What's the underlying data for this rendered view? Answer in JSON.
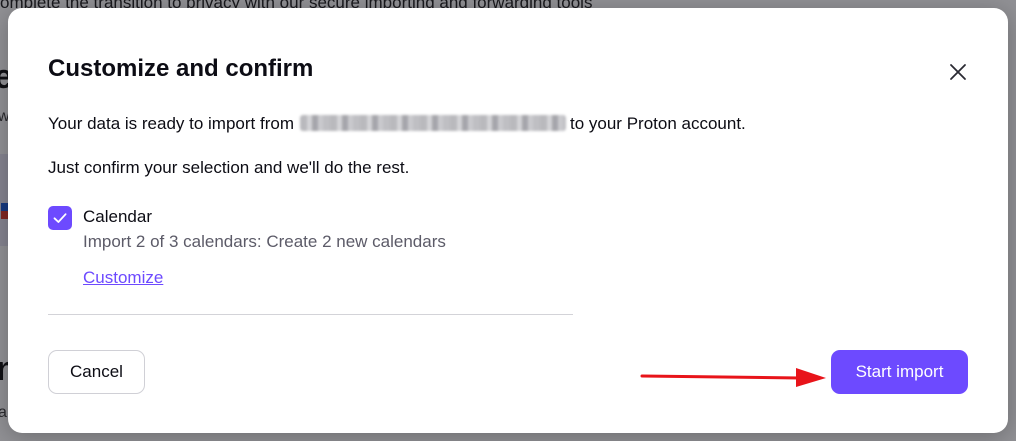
{
  "background": {
    "top_text": "omplete the transition to privacy with our secure importing and forwarding tools",
    "fragment_e": "e",
    "fragment_w": "w",
    "fragment_n": "n",
    "fragment_bottom": "a"
  },
  "modal": {
    "title": "Customize and confirm",
    "intro_before": "Your data is ready to import from",
    "intro_after": "to your Proton account.",
    "confirm_text": "Just confirm your selection and we'll do the rest.",
    "calendar": {
      "checked": true,
      "label": "Calendar",
      "description": "Import 2 of 3 calendars: Create 2 new calendars",
      "customize_link": "Customize"
    },
    "buttons": {
      "cancel": "Cancel",
      "start_import": "Start import"
    }
  },
  "icons": {
    "close": "close-icon",
    "check": "checkmark-icon",
    "arrow": "red-arrow-annotation"
  },
  "colors": {
    "accent": "#6d4aff",
    "text": "#0c0c14",
    "muted": "#5c5b68",
    "annotation": "#e8141a"
  }
}
